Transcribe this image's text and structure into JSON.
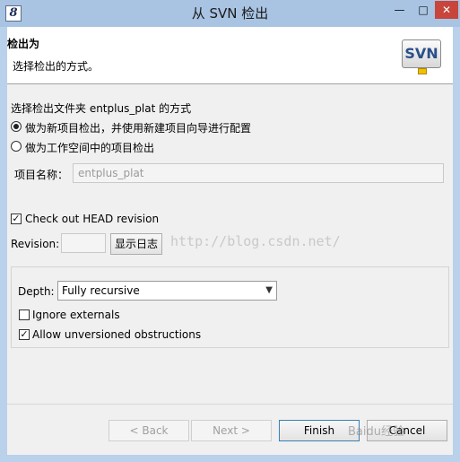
{
  "window": {
    "title": "从 SVN 检出",
    "min_glyph": "—",
    "max_glyph": "□",
    "close_glyph": "✕"
  },
  "banner": {
    "title": "检出为",
    "description": "选择检出的方式。",
    "logo_text": "SVN"
  },
  "checkout_method": {
    "prompt": "选择检出文件夹 entplus_plat 的方式",
    "options": [
      {
        "label": "做为新项目检出，并使用新建项目向导进行配置",
        "selected": true
      },
      {
        "label": "做为工作空间中的项目检出",
        "selected": false
      }
    ]
  },
  "project": {
    "name_label": "项目名称：",
    "name_value": "entplus_plat"
  },
  "revision": {
    "head_label": "Check out HEAD revision",
    "head_checked": true,
    "revision_label": "Revision:",
    "revision_value": "",
    "show_log_label": "显示日志"
  },
  "options": {
    "depth_label": "Depth:",
    "depth_value": "Fully recursive",
    "ignore_externals_label": "Ignore externals",
    "ignore_externals_checked": false,
    "allow_unversioned_label": "Allow unversioned obstructions",
    "allow_unversioned_checked": true
  },
  "buttons": {
    "back": "< Back",
    "next": "Next >",
    "finish": "Finish",
    "cancel": "Cancel"
  },
  "watermark": {
    "url": "http://blog.csdn.net/",
    "corner": "Baidu经验"
  },
  "colors": {
    "title_bar": "#a9c4e3",
    "close_button": "#c7453b",
    "client_bg": "#f0f0f0"
  }
}
